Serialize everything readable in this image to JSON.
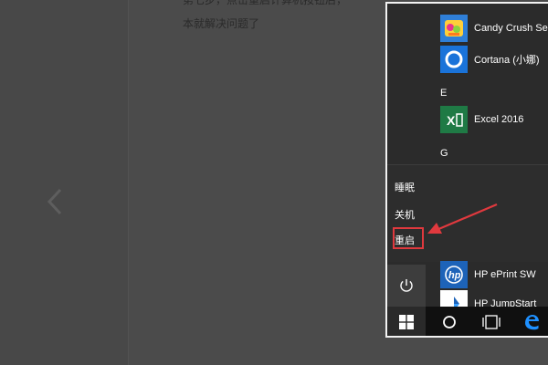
{
  "background": {
    "article_line_1": "第七步，点击重启计算机按钮后，",
    "article_line_2": "本就解决问题了"
  },
  "start_menu": {
    "apps_top": [
      {
        "name": "Candy Crush Se",
        "icon": "candy-crush-icon"
      },
      {
        "name": "Cortana (小娜)",
        "icon": "cortana-icon"
      }
    ],
    "group_e": "E",
    "apps_e": [
      {
        "name": "Excel 2016",
        "icon": "excel-icon"
      }
    ],
    "group_g": "G",
    "apps_bottom": [
      {
        "name": "HP ePrint SW",
        "icon": "hp-icon"
      },
      {
        "name": "HP JumpStart",
        "icon": "hp-jumpstart-icon"
      }
    ],
    "power_menu": {
      "sleep": "睡眠",
      "shutdown": "关机",
      "restart": "重启"
    }
  },
  "colors": {
    "highlight_box": "#e0393e",
    "annotation_arrow": "#e0393e",
    "edge_blue": "#1e90ff"
  }
}
